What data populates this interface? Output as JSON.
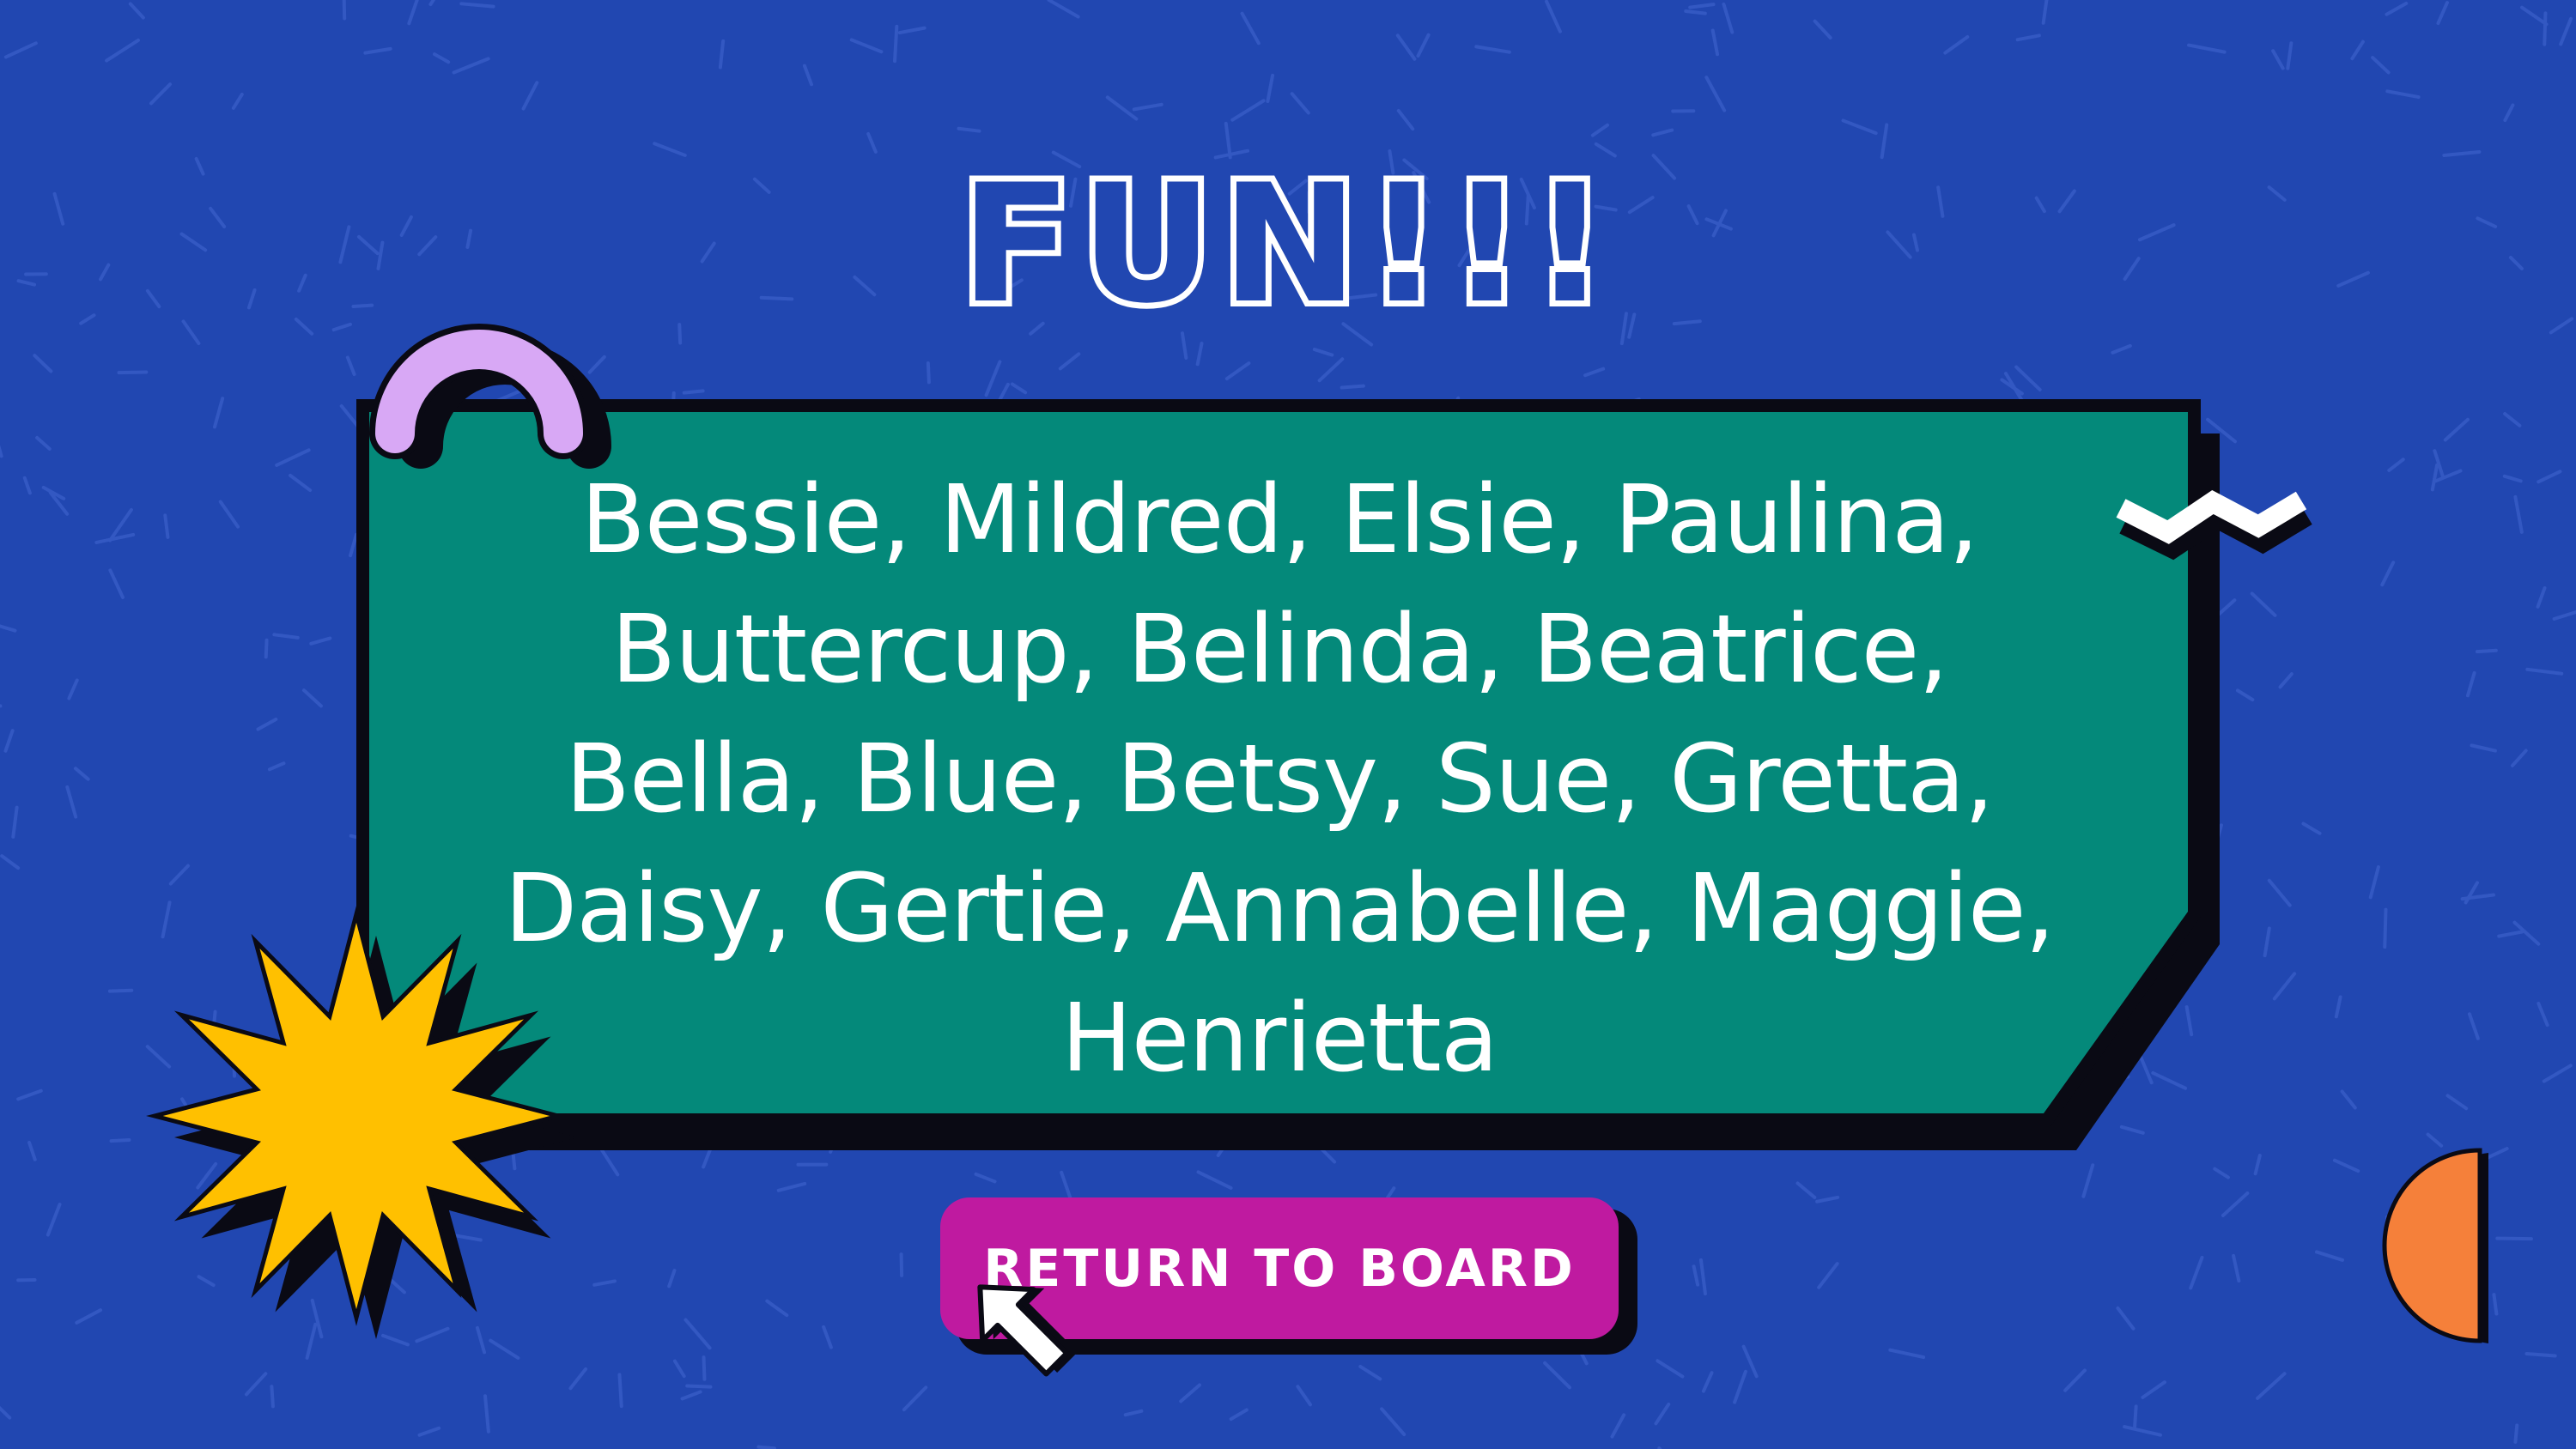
{
  "slide": {
    "title": "FUN!!!",
    "names_text": "Bessie, Mildred, Elsie, Paulina, Buttercup, Belinda, Beatrice, Bella, Blue, Betsy, Sue, Gretta, Daisy, Gertie, Annabelle, Maggie, Henrietta",
    "names_lines": [
      "Bessie, Mildred, Elsie, Paulina,",
      "Buttercup, Belinda, Beatrice,",
      "Bella, Blue, Betsy, Sue, Gretta,",
      "Daisy, Gertie, Annabelle, Maggie,",
      "Henrietta"
    ],
    "return_button_label": "RETURN TO BOARD"
  },
  "colors": {
    "background": "#2147b1",
    "panel": "#04897a",
    "button": "#bf1aa0",
    "starburst": "#ffc000",
    "arch": "#d8a8f5",
    "half_circle": "#f5803a",
    "text": "#ffffff"
  },
  "icons": {
    "decorations": [
      "arch-decoration",
      "zigzag-decoration",
      "starburst-decoration",
      "half-circle-decoration"
    ],
    "cursor": "arrow-cursor-icon"
  }
}
